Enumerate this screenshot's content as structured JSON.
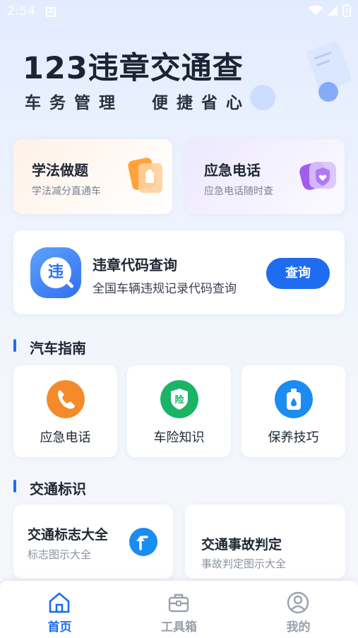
{
  "status_bar": {
    "time": "2:54",
    "notification_glyph": "A"
  },
  "hero": {
    "title": "123违章交通查",
    "subtitle": "车务管理  便捷省心"
  },
  "quick_cards": [
    {
      "title": "学法做题",
      "subtitle": "学法减分直通车",
      "icon": "exam-document-icon"
    },
    {
      "title": "应急电话",
      "subtitle": "应急电话随时查",
      "icon": "shield-heart-icon"
    }
  ],
  "violation_code": {
    "logo_char": "违",
    "title": "违章代码查询",
    "subtitle": "全国车辆违规记录代码查询",
    "button_label": "查询"
  },
  "sections": {
    "car_guide": "汽车指南",
    "traffic_signs": "交通标识"
  },
  "car_guide_items": [
    {
      "label": "应急电话",
      "icon": "phone-icon",
      "color": "#f58a2a"
    },
    {
      "label": "车险知识",
      "icon": "insurance-shield-icon",
      "color": "#19b466"
    },
    {
      "label": "保养技巧",
      "icon": "oil-bottle-icon",
      "color": "#1a8cf2"
    }
  ],
  "traffic_sign_items": [
    {
      "title": "交通标志大全",
      "subtitle": "标志图示大全",
      "icon": "turn-arrow-icon"
    },
    {
      "title": "交通事故判定",
      "subtitle": "事故判定图示大全"
    }
  ],
  "tab_bar": [
    {
      "label": "首页",
      "icon": "home-icon",
      "active": true
    },
    {
      "label": "工具箱",
      "icon": "toolbox-icon",
      "active": false
    },
    {
      "label": "我的",
      "icon": "user-icon",
      "active": false
    }
  ],
  "colors": {
    "accent": "#1e6cf0",
    "inactive_tab": "#9aa1ad",
    "text_primary": "#1f2633"
  }
}
